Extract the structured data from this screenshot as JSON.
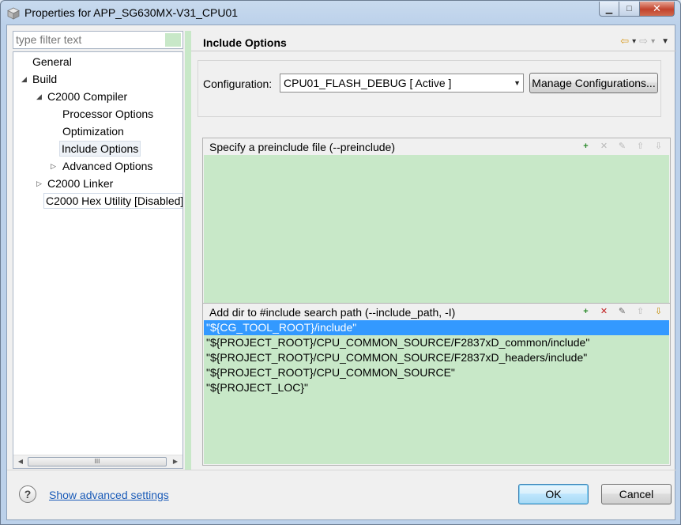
{
  "window": {
    "title": "Properties for APP_SG630MX-V31_CPU01",
    "minimize": "▁",
    "maximize": "□",
    "close": "✕"
  },
  "filter": {
    "placeholder": "type filter text"
  },
  "tree": [
    {
      "label": "General",
      "arrow": ""
    },
    {
      "label": "Build",
      "arrow": "◢"
    },
    {
      "label": "C2000 Compiler",
      "arrow": "◢"
    },
    {
      "label": "Processor Options",
      "arrow": ""
    },
    {
      "label": "Optimization",
      "arrow": ""
    },
    {
      "label": "Include Options",
      "arrow": ""
    },
    {
      "label": "Advanced Options",
      "arrow": "▷"
    },
    {
      "label": "C2000 Linker",
      "arrow": "▷"
    },
    {
      "label": "C2000 Hex Utility  [Disabled]",
      "arrow": ""
    }
  ],
  "scroll": {
    "left": "◀",
    "right": "▶",
    "grip": "III"
  },
  "header": {
    "title": "Include Options",
    "back_icon": "⇦",
    "forward_icon": "⇨",
    "dropdown_icon": "▾",
    "menu_icon": "▼"
  },
  "config": {
    "label": "Configuration:",
    "selected": "CPU01_FLASH_DEBUG  [ Active ]",
    "caret": "▼",
    "manage_label": "Manage Configurations..."
  },
  "preinclude": {
    "title": "Specify a preinclude file (--preinclude)",
    "items": []
  },
  "include_path": {
    "title": "Add dir to #include search path (--include_path, -I)",
    "items": [
      "\"${CG_TOOL_ROOT}/include\"",
      "\"${PROJECT_ROOT}/CPU_COMMON_SOURCE/F2837xD_common/include\"",
      "\"${PROJECT_ROOT}/CPU_COMMON_SOURCE/F2837xD_headers/include\"",
      "\"${PROJECT_ROOT}/CPU_COMMON_SOURCE\"",
      "\"${PROJECT_LOC}\""
    ],
    "selected_index": 0
  },
  "tools": {
    "add": "+",
    "delete": "✕",
    "edit": "✎",
    "up": "⇧",
    "down": "⇩"
  },
  "footer": {
    "help": "?",
    "advanced_link": "Show advanced settings",
    "ok": "OK",
    "cancel": "Cancel"
  }
}
